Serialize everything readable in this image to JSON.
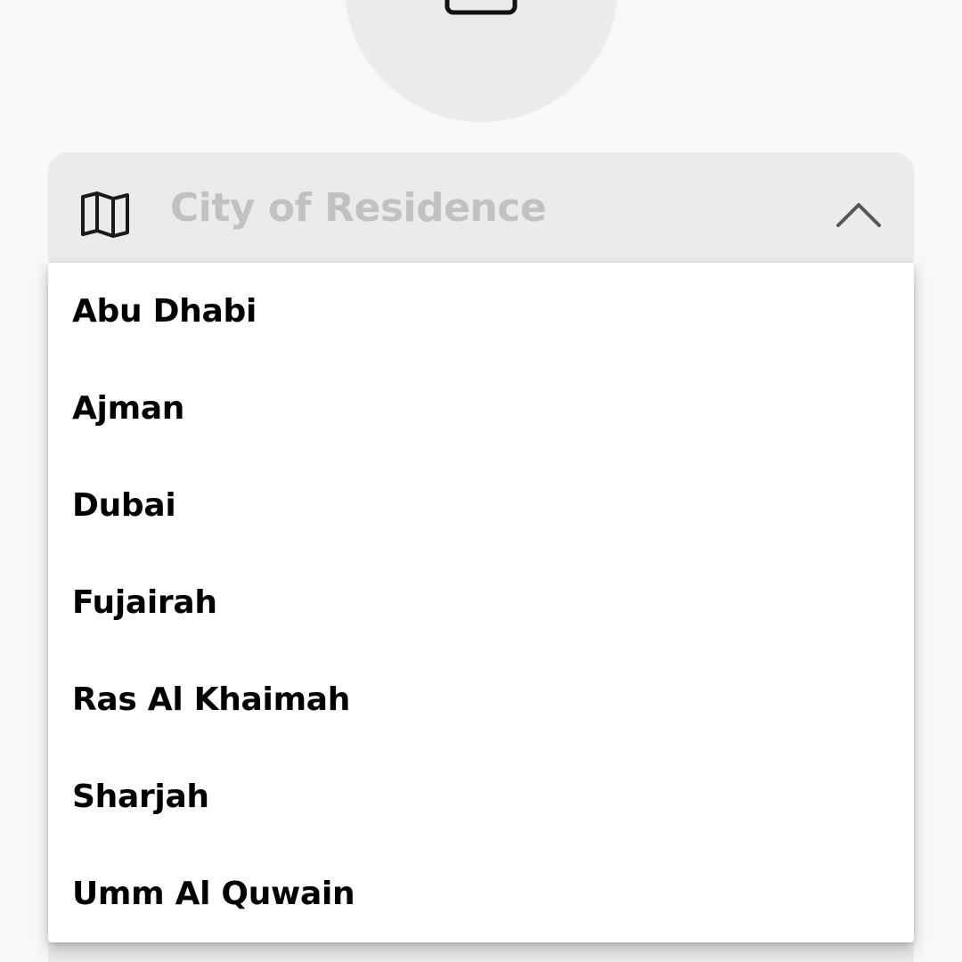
{
  "icons": {
    "camera": "camera-icon",
    "map": "map-icon",
    "chevron": "chevron-up-icon"
  },
  "city_field": {
    "placeholder": "City of Residence"
  },
  "city_options": [
    "Abu Dhabi",
    "Ajman",
    "Dubai",
    "Fujairah",
    "Ras Al Khaimah",
    "Sharjah",
    "Umm Al Quwain"
  ],
  "colors": {
    "background": "#f8f8f8",
    "field_background": "#ebebeb",
    "placeholder_text": "#c1c1c1",
    "option_text": "#000000",
    "dropdown_background": "#ffffff"
  }
}
